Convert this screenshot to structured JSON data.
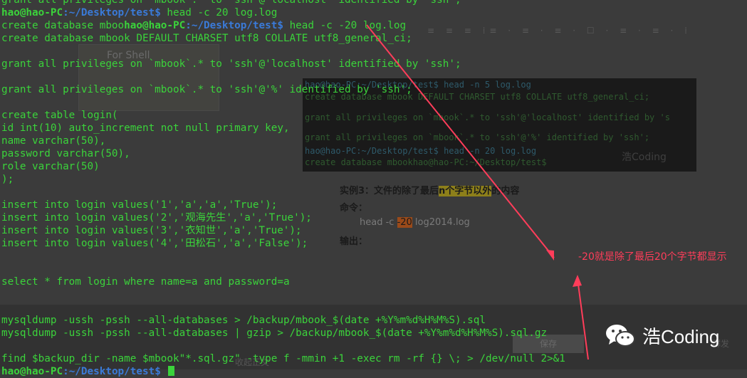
{
  "background": {
    "toolbar_text": "≡ ≡ ≡ ⁞≡ · ≡ · ≡ · ☐ · ≡ · ≡ · ⁞",
    "thumb_text": "For Shell",
    "code_lines": [
      {
        "text": "hao@hao-PC:~/Desktop/test$ head -n 5 log.log",
        "prompt": true
      },
      {
        "text": "create database mbook DEFAULT CHARSET utf8 COLLATE utf8_general_ci;",
        "prompt": false
      },
      {
        "text": "grant all privileges on `mbook`.* to 'ssh'@'localhost' identified by 's",
        "prompt": false
      },
      {
        "text": "grant all privileges on `mbook`.* to 'ssh'@'%' identified by 'ssh';",
        "prompt": false
      },
      {
        "text": "hao@hao-PC:~/Desktop/test$ head -n 20 log.log",
        "prompt": true
      },
      {
        "text": "create database mbookhao@hao-PC:~/Desktop/test$",
        "prompt": false
      }
    ],
    "watermark": "浩Coding",
    "example_title_pre": "实例3：文件的除了最后",
    "example_title_hl": "n个字节以外",
    "example_title_post": "的内容",
    "command_label": "命令：",
    "command_pre": "head -c ",
    "command_hl": "-20",
    "command_post": " log2014.log",
    "output_label": "输出：",
    "footer_collect": "收起正文",
    "footer_save": "保存",
    "footer_group": "群发"
  },
  "terminal": {
    "lines": [
      {
        "kind": "text",
        "text": "grant all privileges on `mbook`.* to 'ssh'@'localhost' identified by 'ssh';"
      },
      {
        "kind": "prompt",
        "user": "hao@hao-PC",
        "path": "~/Desktop/test",
        "cmd": " head -c 20 log.log"
      },
      {
        "kind": "mixed",
        "pre": "create database mboo",
        "user": "hao@hao-PC",
        "path": "~/Desktop/test",
        "cmd": " head -c -20 log.log"
      },
      {
        "kind": "text",
        "text": "create database mbook DEFAULT CHARSET utf8 COLLATE utf8_general_ci;"
      },
      {
        "kind": "text",
        "text": ""
      },
      {
        "kind": "text",
        "text": "grant all privileges on `mbook`.* to 'ssh'@'localhost' identified by 'ssh';"
      },
      {
        "kind": "text",
        "text": ""
      },
      {
        "kind": "text",
        "text": "grant all privileges on `mbook`.* to 'ssh'@'%' identified by 'ssh';"
      },
      {
        "kind": "text",
        "text": ""
      },
      {
        "kind": "text",
        "text": "create table login("
      },
      {
        "kind": "text",
        "text": "id int(10) auto_increment not null primary key,"
      },
      {
        "kind": "text",
        "text": "name varchar(50),"
      },
      {
        "kind": "text",
        "text": "password varchar(50),"
      },
      {
        "kind": "text",
        "text": "role varchar(50)"
      },
      {
        "kind": "text",
        "text": ");"
      },
      {
        "kind": "text",
        "text": ""
      },
      {
        "kind": "text",
        "text": "insert into login values('1','a','a','True');"
      },
      {
        "kind": "text",
        "text": "insert into login values('2','观海先生','a','True');"
      },
      {
        "kind": "text",
        "text": "insert into login values('3','衣知世','a','True');"
      },
      {
        "kind": "text",
        "text": "insert into login values('4','田松石','a','False');"
      },
      {
        "kind": "text",
        "text": ""
      },
      {
        "kind": "text",
        "text": ""
      },
      {
        "kind": "text",
        "text": "select * from login where name=a and password=a"
      },
      {
        "kind": "text",
        "text": ""
      },
      {
        "kind": "text",
        "text": ""
      },
      {
        "kind": "text",
        "text": "mysqldump -ussh -pssh --all-databases > /backup/mbook_$(date +%Y%m%d%H%M%S).sql"
      },
      {
        "kind": "text",
        "text": "mysqldump -ussh -pssh --all-databases | gzip > /backup/mbook_$(date +%Y%m%d%H%M%S).sql.gz"
      },
      {
        "kind": "text",
        "text": ""
      },
      {
        "kind": "text",
        "text": "find $backup_dir -name $mbook\"*.sql.gz\" -type f -mmin +1 -exec rm -rf {} \\; > /dev/null 2>&1"
      },
      {
        "kind": "prompt-cursor",
        "user": "hao@hao-PC",
        "path": "~/Desktop/test",
        "cmd": " "
      }
    ]
  },
  "annotation": {
    "note": "-20就是除了最后20个字节都显示",
    "color": "#ff3d5a"
  },
  "brand": {
    "name": "浩Coding",
    "icon": "wechat-icon"
  }
}
